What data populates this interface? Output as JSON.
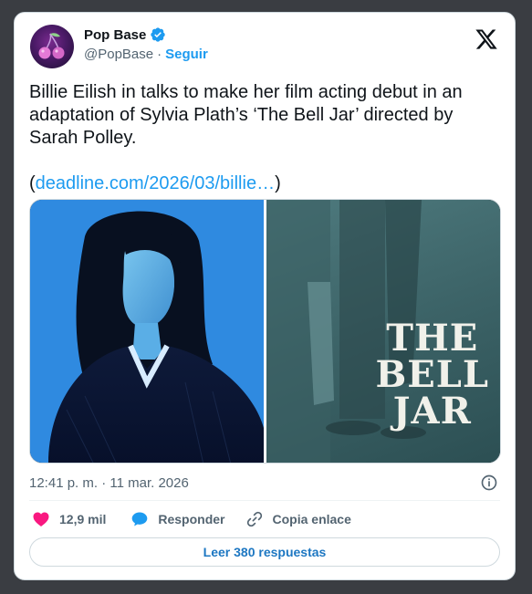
{
  "author": {
    "name": "Pop Base",
    "handle": "@PopBase",
    "separator": "·",
    "follow_label": "Seguir",
    "verified": true
  },
  "tweet": {
    "text": "Billie Eilish in talks to make her film acting debut in an adaptation of Sylvia Plath’s ‘The Bell Jar’ directed by Sarah Polley.",
    "link_open": "(",
    "link_text": "deadline.com/2026/03/billie…",
    "link_close": ")"
  },
  "media": {
    "right_image_title": "THE\nBELL\nJAR"
  },
  "timestamp": "12:41 p. m. · 11 mar. 2026",
  "actions": {
    "likes": "12,9 mil",
    "reply_label": "Responder",
    "copy_label": "Copia enlace"
  },
  "replies_button": "Leer 380 respuestas",
  "colors": {
    "accent": "#1d9bf0",
    "like": "#f91880",
    "text_secondary": "#536471"
  },
  "icons": [
    "cherries-avatar-icon",
    "verified-badge-icon",
    "x-logo-icon",
    "info-icon",
    "heart-icon",
    "reply-bubble-icon",
    "link-icon"
  ]
}
